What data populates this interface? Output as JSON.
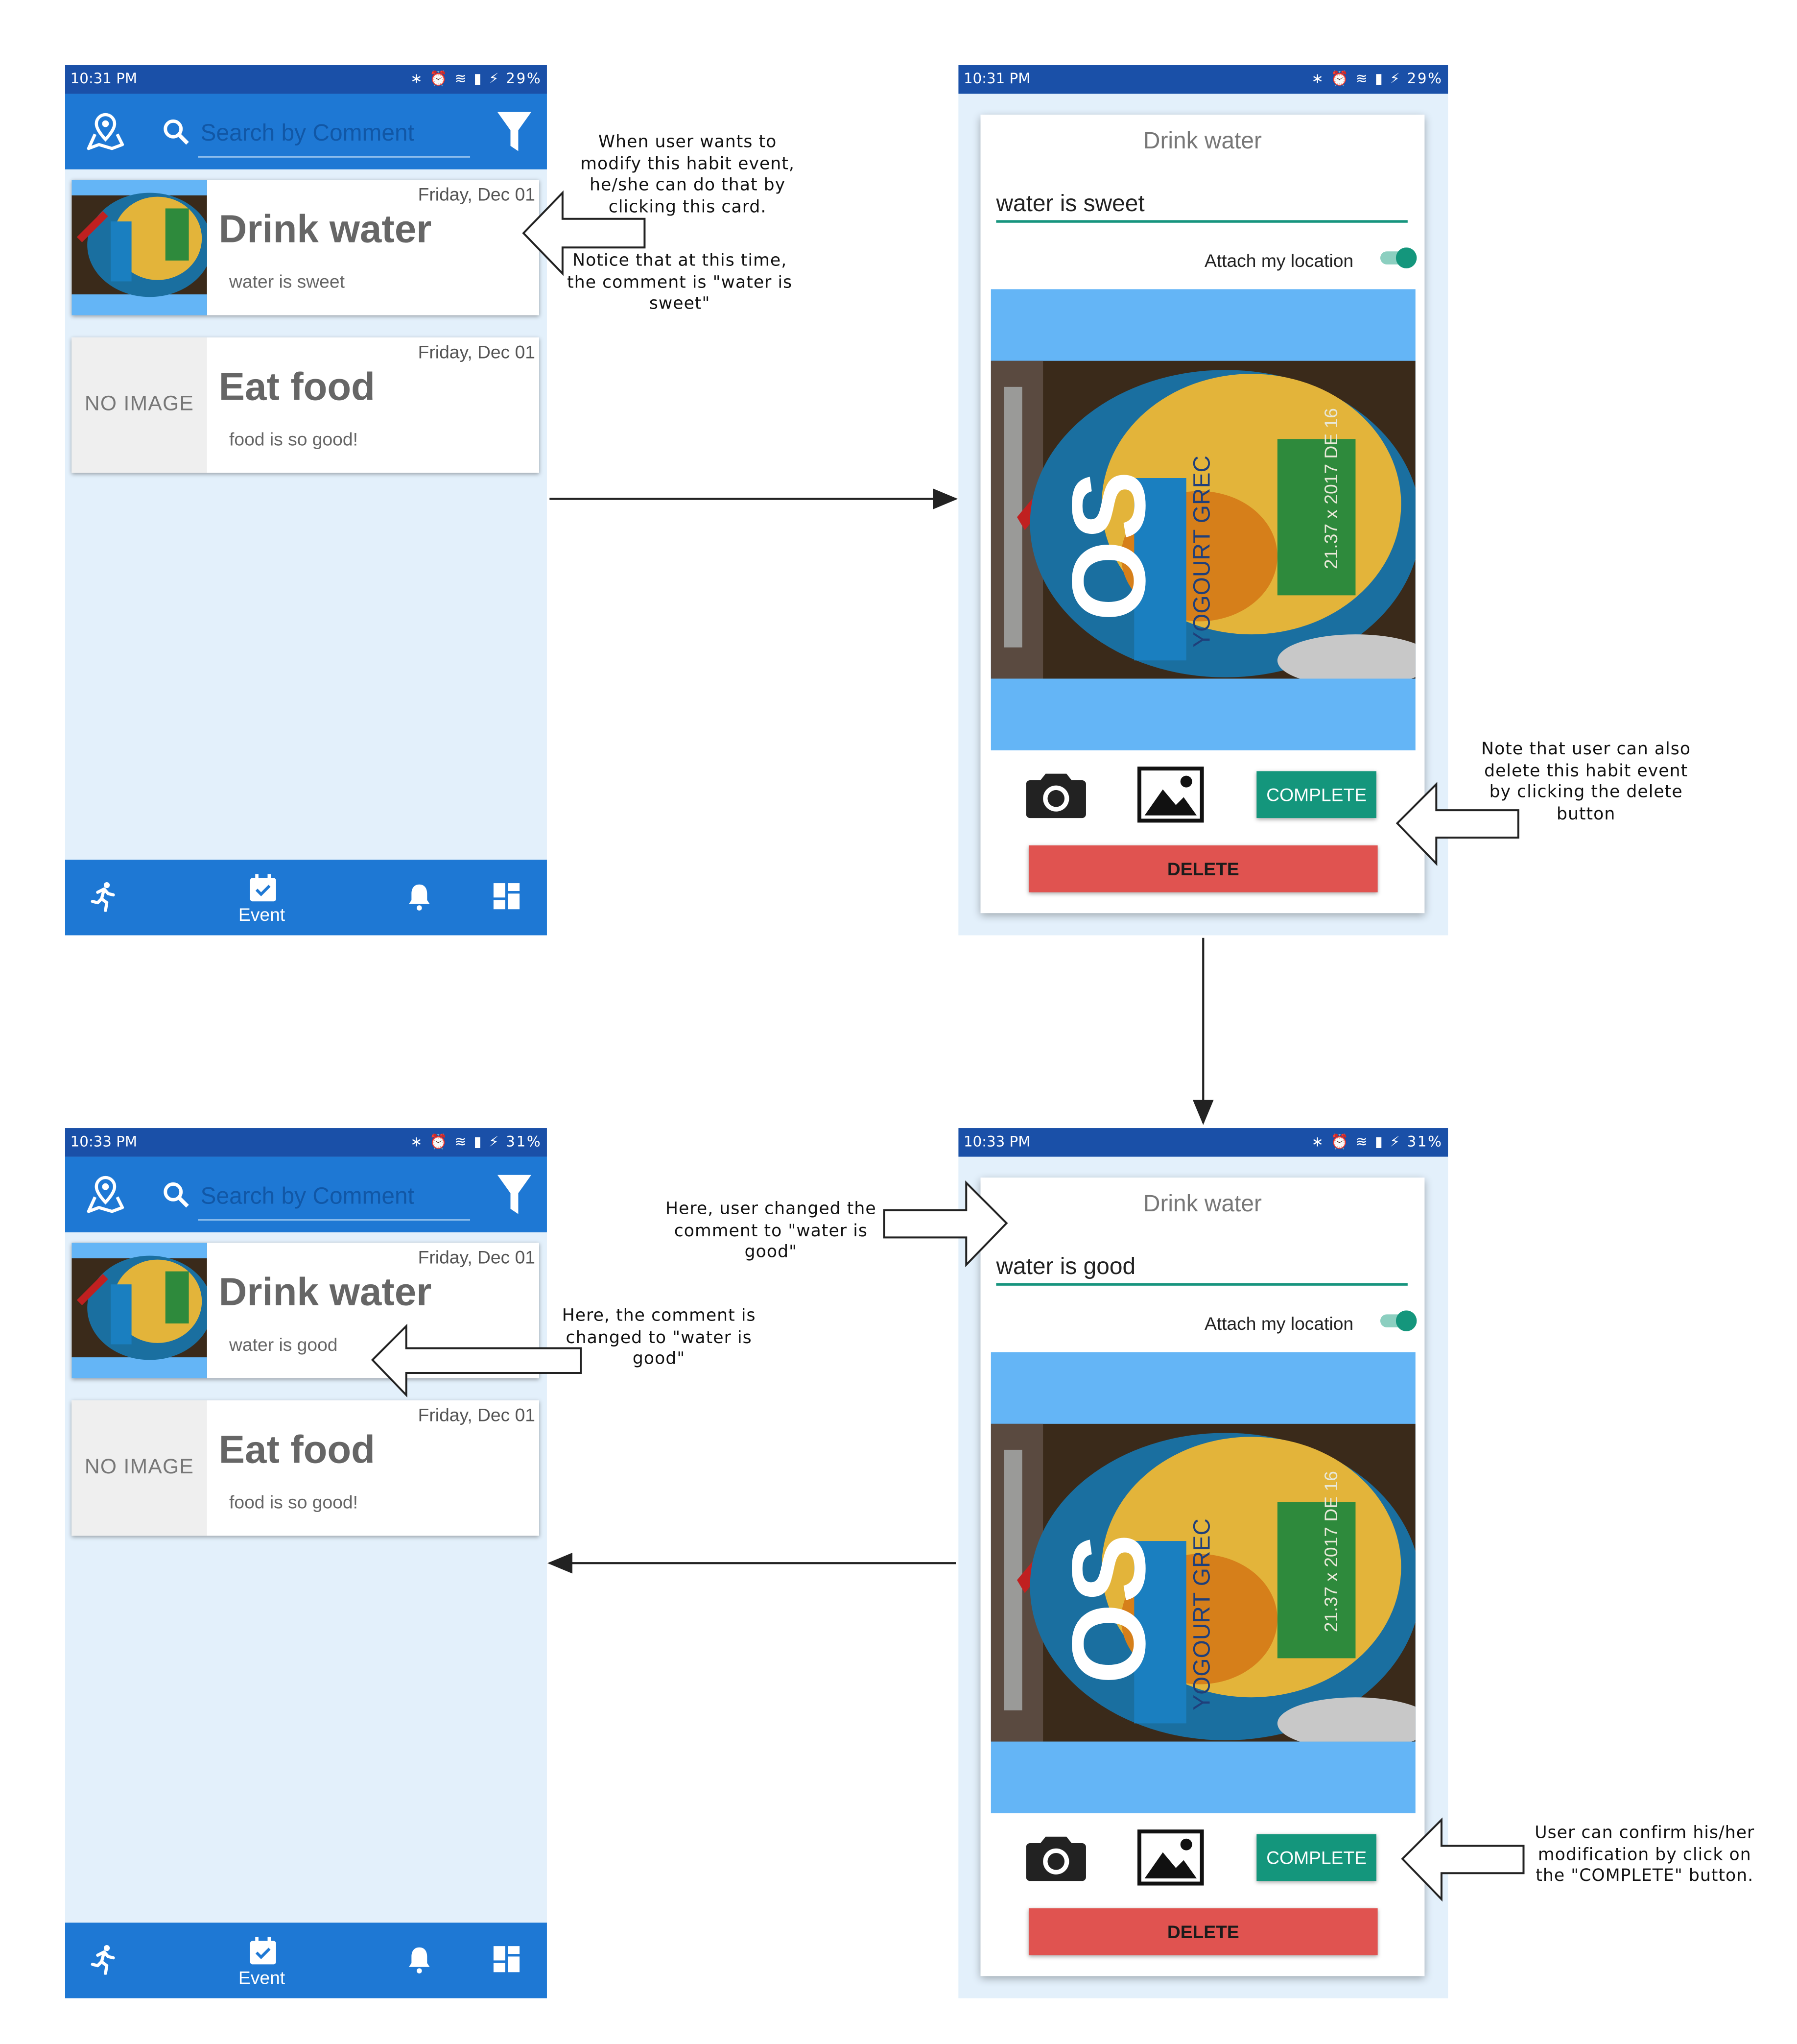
{
  "search": {
    "placeholder": "Search by Comment"
  },
  "screens": {
    "list_before": {
      "time": "10:31 PM",
      "status_icons": "∗ ⏰ ≋ ▮ ⚡",
      "battery": "29%",
      "cards": [
        {
          "date": "Friday, Dec 01",
          "title": "Drink water",
          "comment": "water is sweet"
        },
        {
          "date": "Friday, Dec 01",
          "title": "Eat food",
          "comment": "food is so good!",
          "no_image": "NO IMAGE"
        }
      ],
      "nav_event": "Event"
    },
    "edit_before": {
      "time": "10:31 PM",
      "status_icons": "∗ ⏰ ≋ ▮ ⚡",
      "battery": "29%",
      "title": "Drink water",
      "comment": "water is sweet",
      "attach": "Attach my location",
      "complete": "COMPLETE",
      "delete": "DELETE"
    },
    "edit_after": {
      "time": "10:33 PM",
      "status_icons": "∗ ⏰ ≋ ▮ ⚡",
      "battery": "31%",
      "title": "Drink water",
      "comment": "water is good",
      "attach": "Attach my location",
      "complete": "COMPLETE",
      "delete": "DELETE"
    },
    "list_after": {
      "time": "10:33 PM",
      "status_icons": "∗ ⏰ ≋ ▮ ⚡",
      "battery": "31%",
      "cards": [
        {
          "date": "Friday, Dec 01",
          "title": "Drink water",
          "comment": "water is good"
        },
        {
          "date": "Friday, Dec 01",
          "title": "Eat food",
          "comment": "food is so good!",
          "no_image": "NO IMAGE"
        }
      ],
      "nav_event": "Event"
    }
  },
  "notes": {
    "modify_1": "When user wants to",
    "modify_2": "modify this habit event,",
    "modify_3": "he/she can do that by",
    "modify_4": "clicking this card.",
    "notice_1": "Notice that at this time,",
    "notice_2": "the comment is \"water is",
    "notice_3": "sweet\"",
    "delete_1": "Note that user can also",
    "delete_2": "delete this habit event",
    "delete_3": "by clicking the delete",
    "delete_4": "button",
    "changed_1": "Here, user changed the",
    "changed_2": "comment to \"water is",
    "changed_3": "good\"",
    "result_1": "Here, the comment is",
    "result_2": "changed to \"water is",
    "result_3": "good\"",
    "confirm_1": "User can confirm his/her",
    "confirm_2": "modification by click on",
    "confirm_3": "the \"COMPLETE\" button."
  },
  "colors": {
    "status_bar": "#1a50a8",
    "app_bar": "#1e78d4",
    "screen_bg": "#e3f0fb",
    "accent_teal": "#14967c",
    "delete_red": "#e05350",
    "image_bg": "#64b5f6"
  },
  "icons": [
    "map-pin-icon",
    "search-icon",
    "filter-icon",
    "run-icon",
    "calendar-check-icon",
    "bell-icon",
    "dashboard-icon",
    "camera-icon",
    "gallery-icon",
    "toggle-switch"
  ]
}
